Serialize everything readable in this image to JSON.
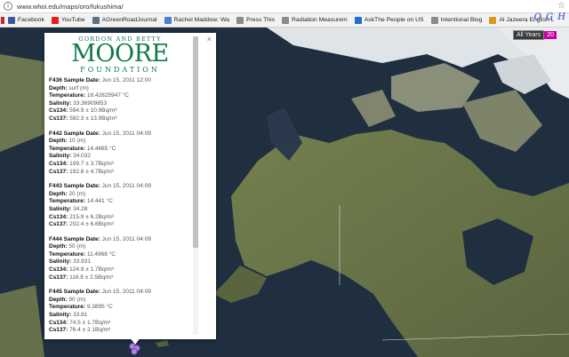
{
  "browser": {
    "url": "www.whoi.edu/maps/oro/fukushima/",
    "bookmarks": [
      {
        "label": "Facebook",
        "color": "#3b5998"
      },
      {
        "label": "YouTube",
        "color": "#e62117"
      },
      {
        "label": "AGreenRoadJournal",
        "color": "#5f6f7f"
      },
      {
        "label": "Rachel Maddow: Wa",
        "color": "#4a7fd0"
      },
      {
        "label": "Press This",
        "color": "#8a8a8a"
      },
      {
        "label": "Radiation Measurem",
        "color": "#8a8a8a"
      },
      {
        "label": "AskThe People on US",
        "color": "#1e6fd6"
      },
      {
        "label": "Intentional Blog",
        "color": "#8a8a8a"
      },
      {
        "label": "Al Jazeera English L",
        "color": "#d99a1e"
      }
    ],
    "handwriting": "O G H"
  },
  "map_controls": {
    "all_years": "All Years",
    "year_badge": "20"
  },
  "popup": {
    "logo": {
      "line1": "GORDON AND BETTY",
      "line2": "MOORE",
      "line3": "FOUNDATION"
    },
    "close": "×",
    "labels": {
      "sample_date": "Sample Date:",
      "depth": "Depth:",
      "temperature": "Temperature:",
      "salinity": "Salinity:",
      "cs134": "Cs134:",
      "cs137": "Cs137:"
    },
    "records": [
      {
        "id": "F436",
        "date": "Jun 15, 2011 12:00",
        "depth": "surf (m)",
        "temperature": "18.42825947 °C",
        "salinity": "33.36909853",
        "cs134": "594.9 ± 10.9Bq/m³",
        "cs137": "582.3 ± 13.9Bq/m³"
      },
      {
        "id": "F442",
        "date": "Jun 15, 2011 04:09",
        "depth": "10 (m)",
        "temperature": "14.4665 °C",
        "salinity": "34.032",
        "cs134": "199.7 ± 3.7Bq/m³",
        "cs137": "192.8 ± 4.7Bq/m³"
      },
      {
        "id": "F443",
        "date": "Jun 15, 2011 04:09",
        "depth": "20 (m)",
        "temperature": "14.441 °C",
        "salinity": "34.28",
        "cs134": "215.9 ± 6.2Bq/m³",
        "cs137": "202.4 ± 6.6Bq/m³"
      },
      {
        "id": "F444",
        "date": "Jun 15, 2011 04:09",
        "depth": "50 (m)",
        "temperature": "11.4968 °C",
        "salinity": "33.931",
        "cs134": "124.9 ± 1.7Bq/m³",
        "cs137": "116.8 ± 2.5Bq/m³"
      },
      {
        "id": "F445",
        "date": "Jun 15, 2011 04:09",
        "depth": "90 (m)",
        "temperature": "9.3895 °C",
        "salinity": "33.81",
        "cs134": "74.5 ± 1.7Bq/m³",
        "cs137": "76.4 ± 2.1Bq/m³"
      }
    ]
  },
  "colors": {
    "ocean": "#1f2f40",
    "land": "#6d7548",
    "ice": "#e3e7ea",
    "moore_green": "#0f7a4a",
    "marker": "#b183e0"
  }
}
